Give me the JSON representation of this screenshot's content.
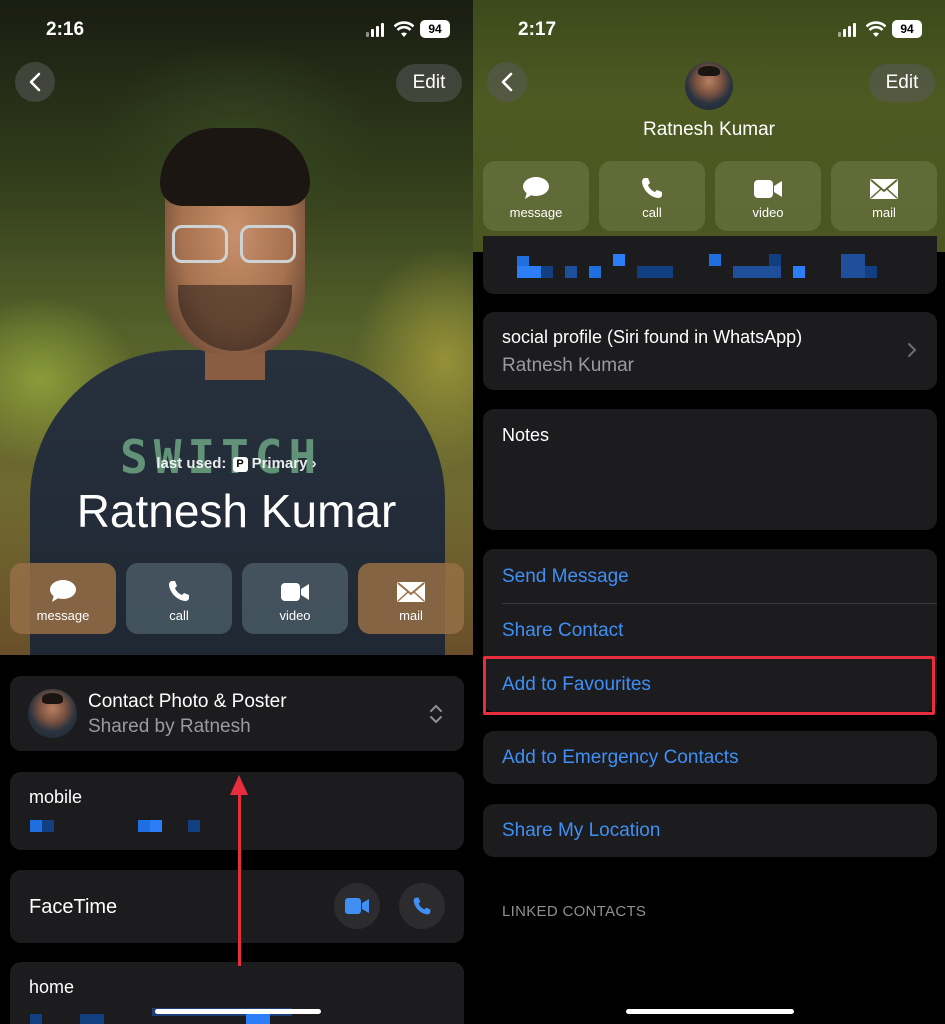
{
  "left": {
    "status": {
      "time": "2:16",
      "battery": "94"
    },
    "nav": {
      "edit": "Edit"
    },
    "last_used": {
      "prefix": "last used:",
      "badge": "P",
      "value": "Primary"
    },
    "name": "Ratnesh Kumar",
    "shirt_text": "SWITCH",
    "actions": [
      {
        "label": "message",
        "icon": "message-icon"
      },
      {
        "label": "call",
        "icon": "phone-icon"
      },
      {
        "label": "video",
        "icon": "video-icon"
      },
      {
        "label": "mail",
        "icon": "mail-icon"
      }
    ],
    "poster": {
      "title": "Contact Photo & Poster",
      "subtitle": "Shared by Ratnesh"
    },
    "mobile": {
      "label": "mobile"
    },
    "facetime": {
      "label": "FaceTime"
    },
    "home": {
      "label": "home"
    }
  },
  "right": {
    "status": {
      "time": "2:17",
      "battery": "94"
    },
    "nav": {
      "edit": "Edit"
    },
    "name": "Ratnesh Kumar",
    "actions": [
      {
        "label": "message",
        "icon": "message-icon"
      },
      {
        "label": "call",
        "icon": "phone-icon"
      },
      {
        "label": "video",
        "icon": "video-icon"
      },
      {
        "label": "mail",
        "icon": "mail-icon"
      }
    ],
    "social": {
      "title": "social profile (Siri found in WhatsApp)",
      "value": "Ratnesh Kumar"
    },
    "notes": {
      "label": "Notes"
    },
    "links": {
      "send_message": "Send Message",
      "share_contact": "Share Contact",
      "add_favourites": "Add to Favourites",
      "emergency": "Add to Emergency Contacts",
      "share_location": "Share My Location"
    },
    "linked_contacts": "LINKED CONTACTS"
  },
  "colors": {
    "link": "#3f8ff5",
    "highlight": "#e82d3d",
    "card": "#1c1c1e"
  }
}
